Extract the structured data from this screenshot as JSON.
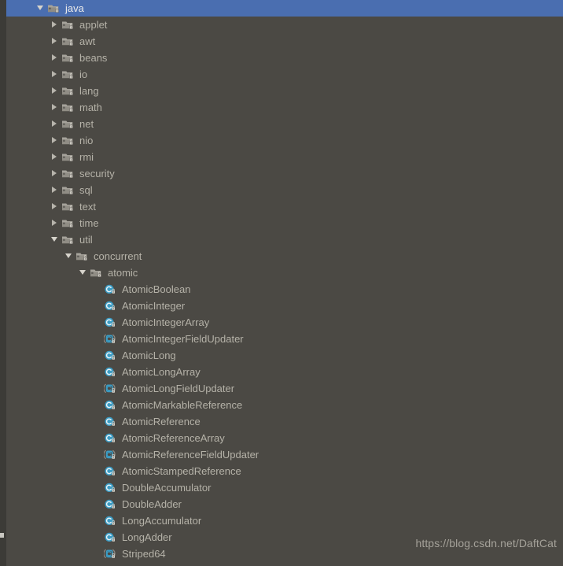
{
  "theme": {
    "background": "#4b4944",
    "gutter": "#3c3b37",
    "selection": "#4a6eb0",
    "text": "#b5b2a8",
    "text_selected": "#e9e9ea",
    "package_icon": "#9b9890",
    "class_icon": "#3b9cc4",
    "watermark": "#a5a29a"
  },
  "watermark": "https://blog.csdn.net/DaftCat",
  "tree": {
    "rows": [
      {
        "label": "java",
        "depth": 2,
        "toggle": "expanded",
        "icon": "package-icon",
        "selected": true
      },
      {
        "label": "applet",
        "depth": 3,
        "toggle": "collapsed",
        "icon": "package-icon",
        "selected": false
      },
      {
        "label": "awt",
        "depth": 3,
        "toggle": "collapsed",
        "icon": "package-icon",
        "selected": false
      },
      {
        "label": "beans",
        "depth": 3,
        "toggle": "collapsed",
        "icon": "package-icon",
        "selected": false
      },
      {
        "label": "io",
        "depth": 3,
        "toggle": "collapsed",
        "icon": "package-icon",
        "selected": false
      },
      {
        "label": "lang",
        "depth": 3,
        "toggle": "collapsed",
        "icon": "package-icon",
        "selected": false
      },
      {
        "label": "math",
        "depth": 3,
        "toggle": "collapsed",
        "icon": "package-icon",
        "selected": false
      },
      {
        "label": "net",
        "depth": 3,
        "toggle": "collapsed",
        "icon": "package-icon",
        "selected": false
      },
      {
        "label": "nio",
        "depth": 3,
        "toggle": "collapsed",
        "icon": "package-icon",
        "selected": false
      },
      {
        "label": "rmi",
        "depth": 3,
        "toggle": "collapsed",
        "icon": "package-icon",
        "selected": false
      },
      {
        "label": "security",
        "depth": 3,
        "toggle": "collapsed",
        "icon": "package-icon",
        "selected": false
      },
      {
        "label": "sql",
        "depth": 3,
        "toggle": "collapsed",
        "icon": "package-icon",
        "selected": false
      },
      {
        "label": "text",
        "depth": 3,
        "toggle": "collapsed",
        "icon": "package-icon",
        "selected": false
      },
      {
        "label": "time",
        "depth": 3,
        "toggle": "collapsed",
        "icon": "package-icon",
        "selected": false
      },
      {
        "label": "util",
        "depth": 3,
        "toggle": "expanded",
        "icon": "package-icon",
        "selected": false
      },
      {
        "label": "concurrent",
        "depth": 4,
        "toggle": "expanded",
        "icon": "package-icon",
        "selected": false
      },
      {
        "label": "atomic",
        "depth": 5,
        "toggle": "expanded",
        "icon": "package-icon",
        "selected": false
      },
      {
        "label": "AtomicBoolean",
        "depth": 6,
        "toggle": "none",
        "icon": "class-icon",
        "selected": false
      },
      {
        "label": "AtomicInteger",
        "depth": 6,
        "toggle": "none",
        "icon": "class-icon",
        "selected": false
      },
      {
        "label": "AtomicIntegerArray",
        "depth": 6,
        "toggle": "none",
        "icon": "class-icon",
        "selected": false
      },
      {
        "label": "AtomicIntegerFieldUpdater",
        "depth": 6,
        "toggle": "none",
        "icon": "abstract-class-icon",
        "selected": false
      },
      {
        "label": "AtomicLong",
        "depth": 6,
        "toggle": "none",
        "icon": "class-icon",
        "selected": false
      },
      {
        "label": "AtomicLongArray",
        "depth": 6,
        "toggle": "none",
        "icon": "class-icon",
        "selected": false
      },
      {
        "label": "AtomicLongFieldUpdater",
        "depth": 6,
        "toggle": "none",
        "icon": "abstract-class-icon",
        "selected": false
      },
      {
        "label": "AtomicMarkableReference",
        "depth": 6,
        "toggle": "none",
        "icon": "class-icon",
        "selected": false
      },
      {
        "label": "AtomicReference",
        "depth": 6,
        "toggle": "none",
        "icon": "class-icon",
        "selected": false
      },
      {
        "label": "AtomicReferenceArray",
        "depth": 6,
        "toggle": "none",
        "icon": "class-icon",
        "selected": false
      },
      {
        "label": "AtomicReferenceFieldUpdater",
        "depth": 6,
        "toggle": "none",
        "icon": "abstract-class-icon",
        "selected": false
      },
      {
        "label": "AtomicStampedReference",
        "depth": 6,
        "toggle": "none",
        "icon": "class-icon",
        "selected": false
      },
      {
        "label": "DoubleAccumulator",
        "depth": 6,
        "toggle": "none",
        "icon": "class-icon",
        "selected": false
      },
      {
        "label": "DoubleAdder",
        "depth": 6,
        "toggle": "none",
        "icon": "class-icon",
        "selected": false
      },
      {
        "label": "LongAccumulator",
        "depth": 6,
        "toggle": "none",
        "icon": "class-icon",
        "selected": false
      },
      {
        "label": "LongAdder",
        "depth": 6,
        "toggle": "none",
        "icon": "class-icon",
        "selected": false
      },
      {
        "label": "Striped64",
        "depth": 6,
        "toggle": "none",
        "icon": "abstract-class-icon",
        "selected": false
      }
    ]
  }
}
